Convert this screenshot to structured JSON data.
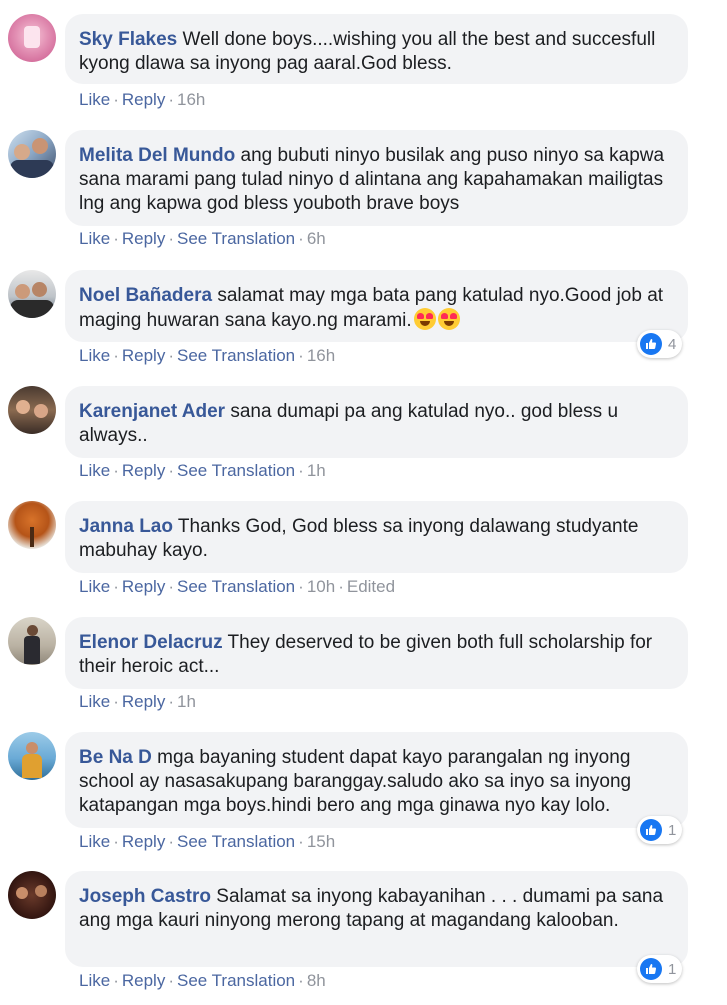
{
  "colors": {
    "author": "#385898",
    "action": "#4b67a1",
    "meta": "#90949c",
    "bubble": "#f2f3f5",
    "like": "#1877f2"
  },
  "comments": [
    {
      "author": "Sky Flakes",
      "text": "Well done boys....wishing you all the best and succesfull kyong dlawa sa inyong pag aaral.God bless.",
      "like": "Like",
      "reply": "Reply",
      "translation": "",
      "time": "16h"
    },
    {
      "author": "Melita Del Mundo",
      "text": "ang bubuti ninyo busilak ang puso ninyo sa kapwa sana marami pang tulad ninyo d alintana ang kapahamakan mailigtas lng ang kapwa god bless youboth brave boys",
      "like": "Like",
      "reply": "Reply",
      "translation": "See Translation",
      "time": "6h"
    },
    {
      "author": "Noel Bañadera",
      "text": "salamat may mga bata pang katulad nyo.Good job at maging huwaran sana kayo.ng marami.",
      "like": "Like",
      "reply": "Reply",
      "translation": "See Translation",
      "time": "16h",
      "reactions": "4"
    },
    {
      "author": "Karenjanet Ader",
      "text": "sana dumapi pa ang katulad nyo.. god bless u always..",
      "like": "Like",
      "reply": "Reply",
      "translation": "See Translation",
      "time": "1h"
    },
    {
      "author": "Janna Lao",
      "text": "Thanks God, God bless sa inyong dalawang studyante mabuhay kayo.",
      "like": "Like",
      "reply": "Reply",
      "translation": "See Translation",
      "time": "10h",
      "edited": "Edited"
    },
    {
      "author": "Elenor Delacruz",
      "text": "They deserved to be given both full scholarship for their heroic act...",
      "like": "Like",
      "reply": "Reply",
      "translation": "",
      "time": "1h"
    },
    {
      "author": "Be Na D",
      "text": "mga bayaning student dapat kayo parangalan ng inyong school ay nasasakupang baranggay.saludo ako sa inyo sa inyong katapangan mga boys.hindi bero ang mga ginawa nyo kay lolo.",
      "like": "Like",
      "reply": "Reply",
      "translation": "See Translation",
      "time": "15h",
      "reactions": "1"
    },
    {
      "author": "Joseph Castro",
      "text": "Salamat sa inyong kabayanihan . . . dumami pa sana ang mga kauri ninyong merong tapang at magandang kalooban.",
      "like": "Like",
      "reply": "Reply",
      "translation": "See Translation",
      "time": "8h",
      "reactions": "1"
    }
  ],
  "sep": "·"
}
